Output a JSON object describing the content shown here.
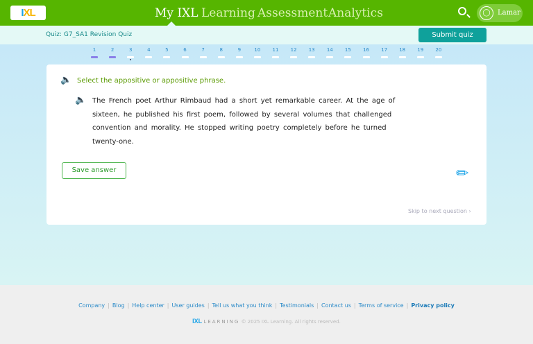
{
  "header": {
    "nav": [
      "My IXL",
      "Learning",
      "Assessment",
      "Analytics"
    ],
    "user": "Lamar"
  },
  "quiz": {
    "title": "Quiz: G7_SA1 Revision Quiz",
    "submit": "Submit quiz"
  },
  "questions": [
    "1",
    "2",
    "3",
    "4",
    "5",
    "6",
    "7",
    "8",
    "9",
    "10",
    "11",
    "12",
    "13",
    "14",
    "15",
    "16",
    "17",
    "18",
    "19",
    "20"
  ],
  "question": {
    "prompt": "Select the appositive or appositive phrase.",
    "passage": "The French poet Arthur Rimbaud had a short yet remarkable career. At the age of sixteen, he published his first poem, followed by several volumes that challenged convention and morality. He stopped writing poetry completely before he turned twenty-one.",
    "save": "Save answer",
    "skip": "Skip to next question ›"
  },
  "footer": {
    "links": [
      "Company",
      "Blog",
      "Help center",
      "User guides",
      "Tell us what you think",
      "Testimonials",
      "Contact us",
      "Terms of service"
    ],
    "privacy": "Privacy policy",
    "logo": "IXL LEARNING",
    "copyright": "© 2025 IXL Learning. All rights reserved."
  }
}
